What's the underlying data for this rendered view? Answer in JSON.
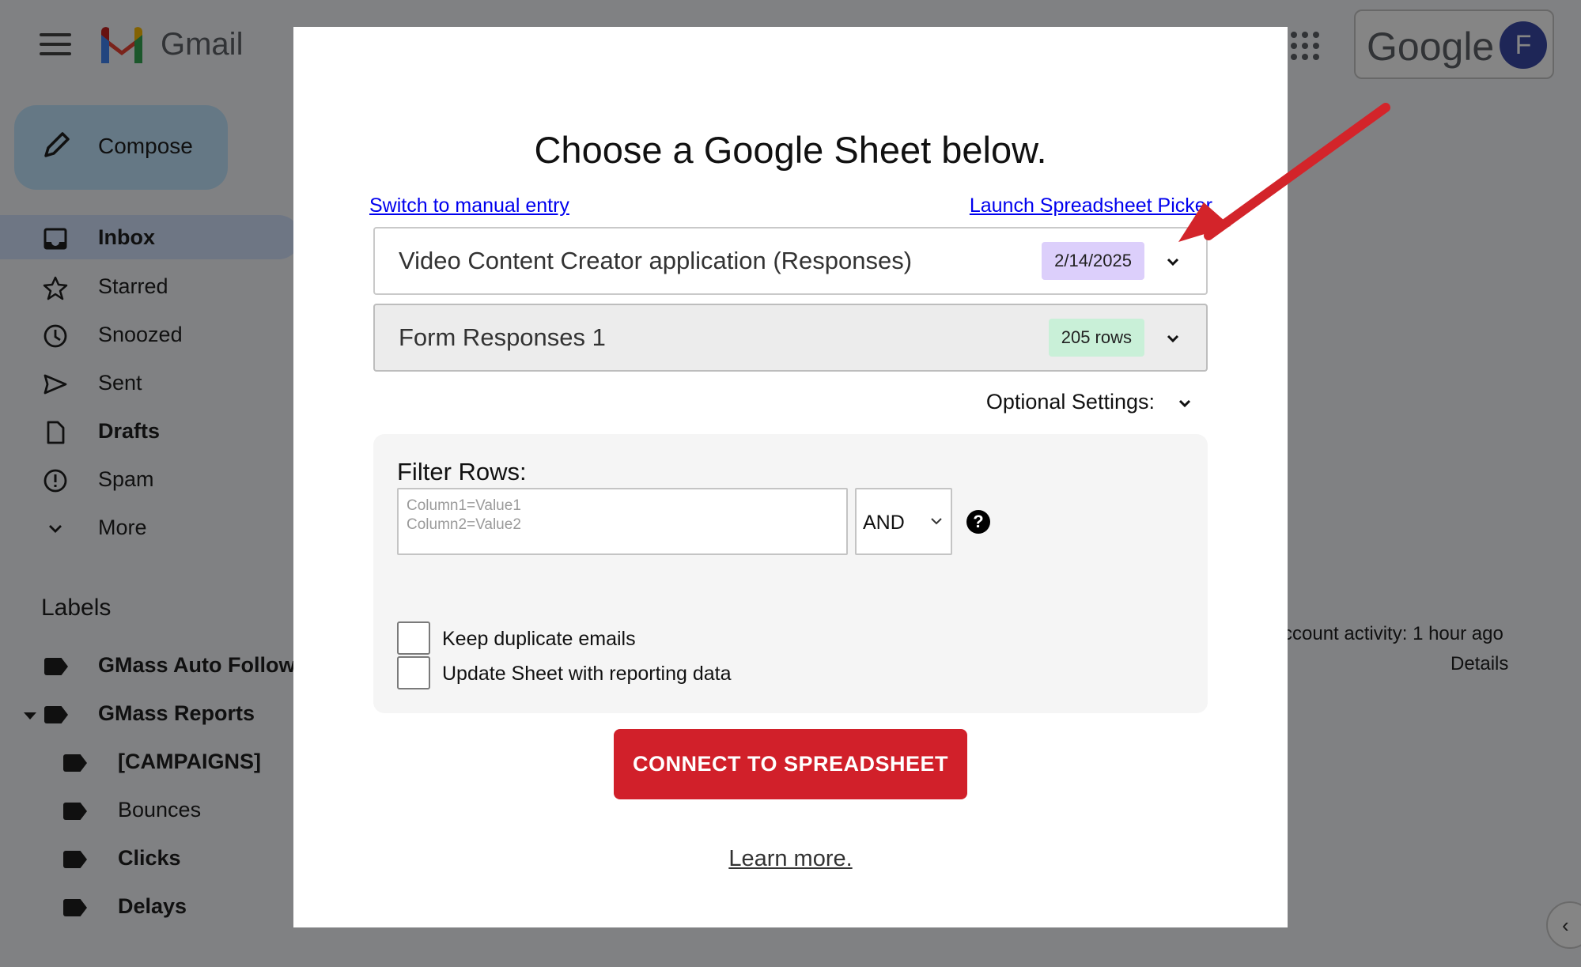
{
  "gmail": {
    "brand": "Gmail",
    "search_label": "Google",
    "avatar_initial": "F",
    "compose_label": "Compose",
    "nav_items": [
      {
        "label": "Inbox",
        "icon": "inbox-icon"
      },
      {
        "label": "Starred",
        "icon": "star-icon"
      },
      {
        "label": "Snoozed",
        "icon": "clock-icon"
      },
      {
        "label": "Sent",
        "icon": "send-icon"
      },
      {
        "label": "Drafts",
        "icon": "draft-icon"
      },
      {
        "label": "Spam",
        "icon": "spam-icon"
      },
      {
        "label": "More",
        "icon": "chevron-down-icon"
      }
    ],
    "labels_heading": "Labels",
    "labels": [
      {
        "label": "GMass Auto Follow"
      },
      {
        "label": "GMass Reports"
      },
      {
        "label": "[CAMPAIGNS]"
      },
      {
        "label": "Bounces"
      },
      {
        "label": "Clicks"
      },
      {
        "label": "Delays"
      }
    ],
    "activity_text": "ccount activity: 1 hour ago",
    "details_text": "Details",
    "toggle_glyph": "‹"
  },
  "modal": {
    "title": "Choose a Google Sheet below.",
    "link_manual": "Switch to manual entry",
    "link_picker": "Launch Spreadsheet Picker",
    "sheet_select": {
      "value": "Video Content Creator application (Responses)",
      "badge": "2/14/2025"
    },
    "tab_select": {
      "value": "Form Responses 1",
      "badge": "205 rows"
    },
    "optional_settings": "Optional Settings:",
    "filter": {
      "label": "Filter Rows:",
      "placeholder_line1": "Column1=Value1",
      "placeholder_line2": "Column2=Value2",
      "operator": "AND",
      "help_glyph": "?"
    },
    "checkboxes": [
      {
        "label": "Keep duplicate emails",
        "checked": false
      },
      {
        "label": "Update Sheet with reporting data",
        "checked": false
      }
    ],
    "connect_button": "CONNECT TO SPREADSHEET",
    "learn_more": "Learn more."
  },
  "colors": {
    "accent_red": "#d1202a",
    "link_blue": "#0000ee",
    "date_badge": "#dccffb",
    "rows_badge": "#c9f0d8",
    "annotation_arrow": "#d3242a"
  }
}
